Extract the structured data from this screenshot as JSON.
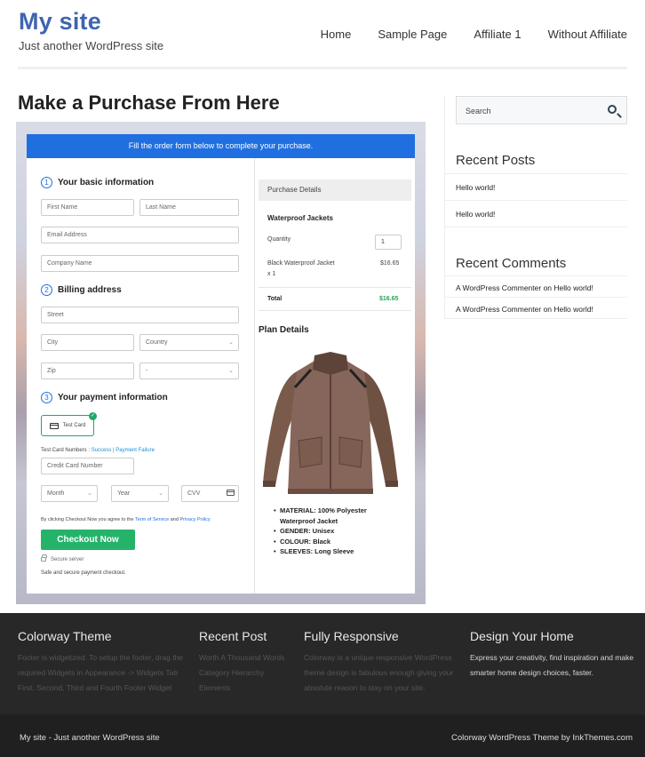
{
  "header": {
    "site_title": "My site",
    "tagline": "Just another WordPress site",
    "nav": [
      "Home",
      "Sample Page",
      "Affiliate 1",
      "Without Affiliate"
    ]
  },
  "page_title": "Make a Purchase From Here",
  "checkout": {
    "banner": "Fill the order form below to complete your purchase.",
    "step1": {
      "num": "1",
      "label": "Your basic information"
    },
    "first_name": "First Name",
    "last_name": "Last Name",
    "email": "Email Address",
    "company": "Company Name",
    "step2": {
      "num": "2",
      "label": "Billing address"
    },
    "street": "Street",
    "city": "City",
    "country": "Country",
    "zip": "Zip",
    "state": "-",
    "step3": {
      "num": "3",
      "label": "Your payment information"
    },
    "test_card": "Test Card",
    "test_numbers_prefix": "Test Card Numbers : ",
    "success": "Success",
    "separator": " | ",
    "failure": "Payment Failure",
    "card_number": "Credit Card Number",
    "month": "Month",
    "year": "Year",
    "cvv": "CVV",
    "agree_prefix": "By clicking Checkout Now you agree to the ",
    "terms": "Term of Service",
    "and": " and ",
    "privacy": "Privacy Policy",
    "checkout_button": "Checkout Now",
    "secure": "Secure server",
    "safe": "Safe and secure payment checkout.",
    "purchase_details": "Purchase Details",
    "product_title": "Waterproof Jackets",
    "quantity_label": "Quantity",
    "quantity_value": "1",
    "item_name": "Black Waterproof Jacket",
    "item_qty": "x 1",
    "item_price": "$16.65",
    "total_label": "Total",
    "total_value": "$16.65",
    "plan_details": "Plan Details",
    "features": [
      "MATERIAL: 100% Polyester Waterproof Jacket",
      "GENDER: Unisex",
      "COLOUR: Black",
      "SLEEVES: Long Sleeve"
    ]
  },
  "sidebar": {
    "search_placeholder": "Search",
    "recent_posts_title": "Recent Posts",
    "recent_posts": [
      "Hello world!",
      "Hello world!"
    ],
    "recent_comments_title": "Recent Comments",
    "comments": [
      {
        "author": "A WordPress Commenter",
        "on": " on ",
        "post": "Hello world!"
      },
      {
        "author": "A WordPress Commenter",
        "on": " on ",
        "post": "Hello world!"
      }
    ]
  },
  "footer": {
    "col1": {
      "title": "Colorway Theme",
      "text": [
        "Footer is widgetized. To setup the footer, drag the",
        "required Widgets in Appearance -> Widgets Tab",
        "First, Second, Third and Fourth Footer Widget"
      ]
    },
    "col2": {
      "title": "Recent Post",
      "text": [
        "Worth A Thousand Words",
        "Category Hierarchy",
        "Elements"
      ]
    },
    "col3": {
      "title": "Fully Responsive",
      "text": [
        "Colorway is a unique responsive WordPress",
        "theme design is fabulous enough giving your",
        "absolute reason to stay on your site."
      ]
    },
    "col4": {
      "title": "Design Your Home",
      "text": [
        "Express your creativity, find inspiration and make",
        "smarter home design choices, faster."
      ]
    },
    "bottom_left": "My site - Just another WordPress site",
    "bottom_right": "Colorway WordPress Theme by InkThemes.com"
  }
}
